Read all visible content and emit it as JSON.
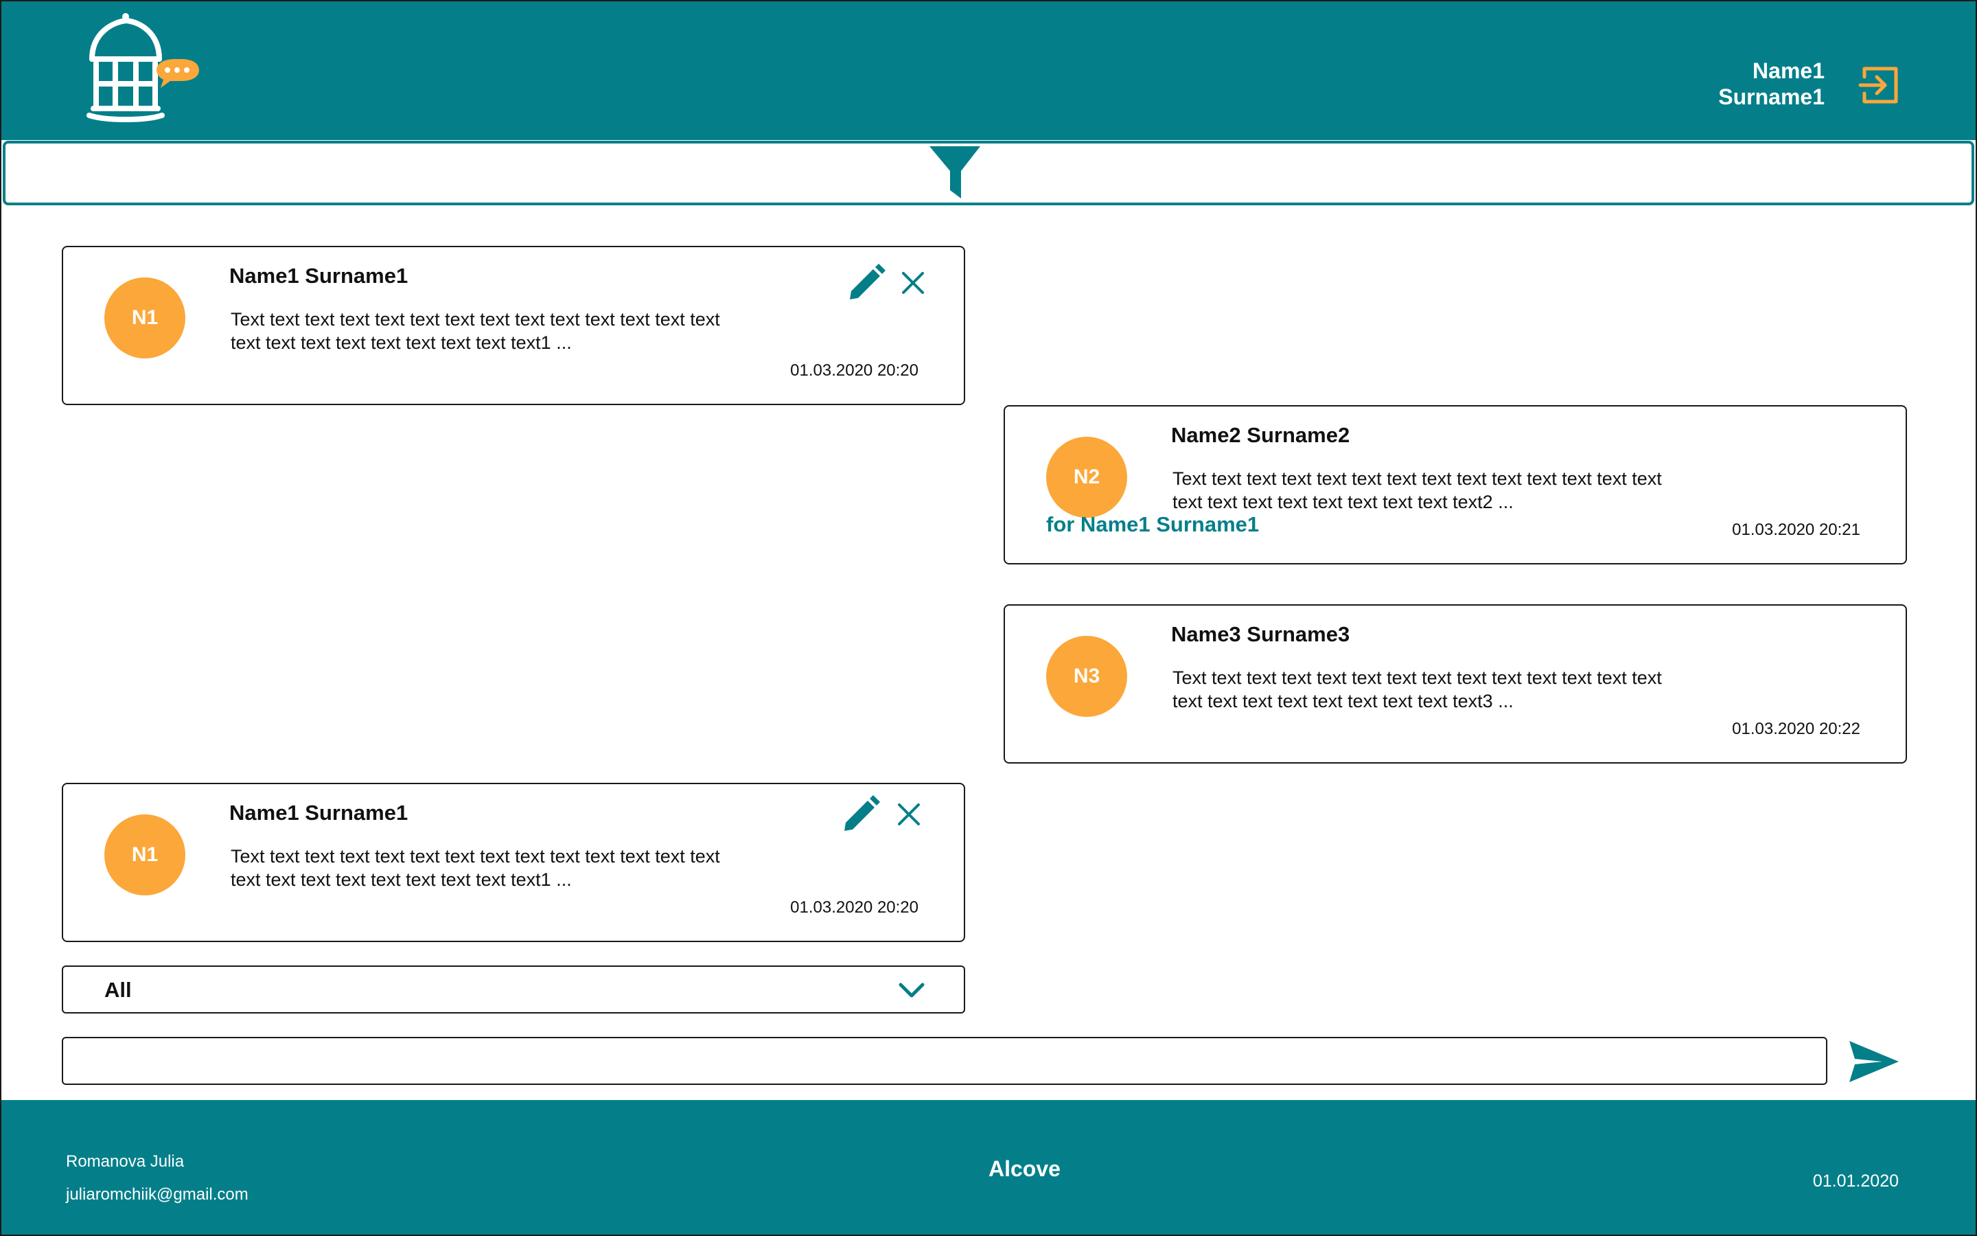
{
  "colors": {
    "teal": "#047f8a",
    "orange": "#fba73a",
    "text": "#111111",
    "white": "#ffffff"
  },
  "header": {
    "logo": "gazebo-chat-logo-icon",
    "user_first": "Name1",
    "user_last": "Surname1",
    "logout_icon": "logout-icon"
  },
  "filter": {
    "icon": "filter-icon"
  },
  "messages": [
    {
      "initials": "N1",
      "author": "Name1 Surname1",
      "text_line1": "Text text text text text text text text text text text text text text",
      "text_line2": "text text text text text text text text text1 ...",
      "recipient": "",
      "time": "01.03.2020 20:20",
      "editable": true
    },
    {
      "initials": "N2",
      "author": "Name2 Surname2",
      "text_line1": "Text text text text text text text text text text text text text text",
      "text_line2": "text text text text text text text text text2 ...",
      "recipient": "for Name1 Surname1",
      "time": "01.03.2020 20:21",
      "editable": false
    },
    {
      "initials": "N3",
      "author": "Name3 Surname3",
      "text_line1": "Text text text text text text text text text text text text text text",
      "text_line2": "text text text text text text text text text3 ...",
      "recipient": "",
      "time": "01.03.2020 20:22",
      "editable": false
    },
    {
      "initials": "N1",
      "author": "Name1 Surname1",
      "text_line1": "Text text text text text text text text text text text text text text",
      "text_line2": "text text text text text text text text text1 ...",
      "recipient": "",
      "time": "01.03.2020 20:20",
      "editable": true
    }
  ],
  "recipient_select": {
    "selected": "All"
  },
  "composer": {
    "value": "",
    "placeholder": "",
    "send_icon": "send-icon"
  },
  "footer": {
    "author_name": "Romanova Julia",
    "author_email": "juliaromchiik@gmail.com",
    "brand": "Alcove",
    "date": "01.01.2020"
  }
}
